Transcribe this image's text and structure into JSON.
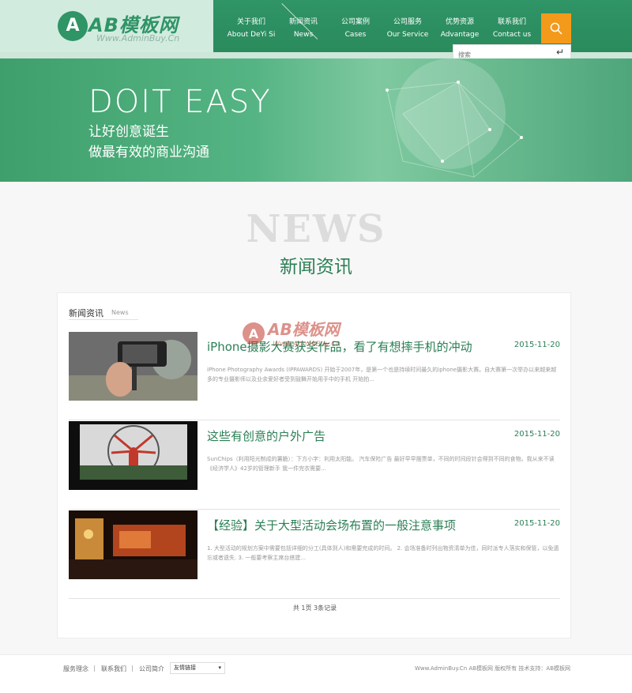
{
  "header": {
    "logo_mark": "A",
    "logo_text": "AB模板网",
    "logo_sub": "Www.AdminBuy.Cn",
    "nav": [
      {
        "cn": "关于我们",
        "en": "About DeYi Si"
      },
      {
        "cn": "新闻资讯",
        "en": "News"
      },
      {
        "cn": "公司案例",
        "en": "Cases"
      },
      {
        "cn": "公司服务",
        "en": "Our Service"
      },
      {
        "cn": "优势资源",
        "en": "Advantage"
      },
      {
        "cn": "联系我们",
        "en": "Contact us"
      }
    ],
    "search_placeholder": "搜索",
    "search_icon": "search-icon",
    "enter_icon": "enter-icon",
    "accent_color": "#2f9466",
    "search_color": "#f39a1b"
  },
  "banner": {
    "slogan": "DOIT EASY",
    "line1": "让好创意诞生",
    "line2": "做最有效的商业沟通"
  },
  "section": {
    "en_title": "NEWS",
    "cn_title": "新闻资讯"
  },
  "panel": {
    "title": "新闻资讯",
    "subtitle": "News",
    "items": [
      {
        "title": "iPhone摄影大赛获奖作品，看了有想摔手机的冲动",
        "date": "2015-11-20",
        "desc": "iPhone Photography Awards (IPPAWARDS) 开始于2007年，是第一个也是持续时间最久的iphone摄影大赛。自大赛第一次举办以来越来越多的专业摄影师以及业余爱好者受到鼓舞开始用手中的手机 开始拍..."
      },
      {
        "title": "这些有创意的户外广告",
        "date": "2015-11-20",
        "desc": "SunChips（利用阳光制成的薯脆）：下方小字：利用太阳能。 汽车保险广告 最好早早摆票单，不同的时间段针会得到不同的食物。我从来不读《经济学人》42岁的管理新手 我一件完衣需要..."
      },
      {
        "title": "【经验】关于大型活动会场布置的一般注意事项",
        "date": "2015-11-20",
        "desc": "1. 大型活动的规划方案中需要包括详细的分工(具体到人)和需要完成的时间。 2. 会场准备时列出物资清单为佳，同时派专人落实和保管，以免遗忘或者遗失. 3. 一般要考察主席台搭建..."
      }
    ],
    "pagination": "共 1页 3条记录"
  },
  "watermark": {
    "mark": "A",
    "text": "AB模板网",
    "sub": "Www.AdminBuy.Cn"
  },
  "footer": {
    "links": [
      "服务理念",
      "联系我们",
      "公司简介"
    ],
    "select_value": "友情链接",
    "copyright": "Www.AdminBuy.Cn AB模板网 版权所有   技术支持：AB模板网"
  }
}
